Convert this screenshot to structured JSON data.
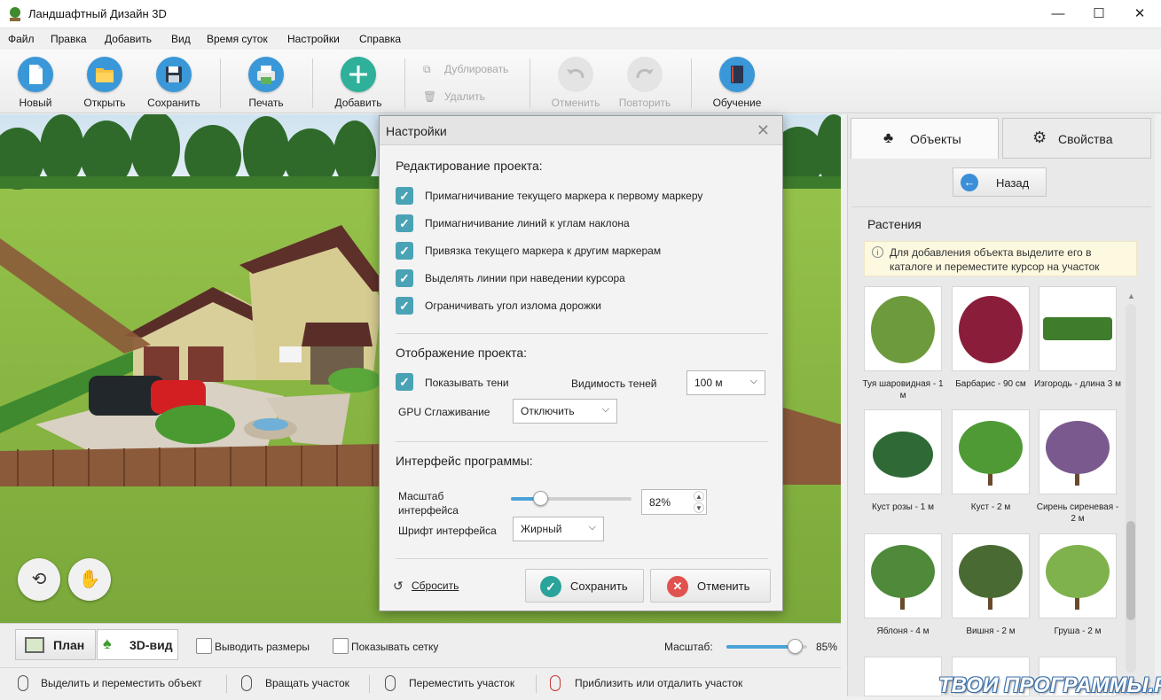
{
  "window": {
    "title": "Ландшафтный Дизайн 3D",
    "minimize": "—",
    "maximize": "☐",
    "close": "✕"
  },
  "menu": [
    "Файл",
    "Правка",
    "Добавить",
    "Вид",
    "Время суток",
    "Настройки",
    "Справка"
  ],
  "toolbar": {
    "new": "Новый",
    "open": "Открыть",
    "save": "Сохранить",
    "print": "Печать",
    "add": "Добавить",
    "duplicate": "Дублировать",
    "delete": "Удалить",
    "undo": "Отменить",
    "redo": "Повторить",
    "tutorial": "Обучение"
  },
  "dialog": {
    "title": "Настройки",
    "section_edit": "Редактирование проекта:",
    "edit_options": [
      {
        "label": "Примагничивание текущего маркера к первому маркеру",
        "checked": true
      },
      {
        "label": "Примагничивание линий к углам наклона",
        "checked": true
      },
      {
        "label": "Привязка текущего маркера к другим маркерам",
        "checked": true
      },
      {
        "label": "Выделять линии при наведении курсора",
        "checked": true
      },
      {
        "label": "Ограничивать угол излома дорожки",
        "checked": true
      }
    ],
    "section_display": "Отображение проекта:",
    "show_shadows": "Показывать тени",
    "shadow_visibility_label": "Видимость теней",
    "shadow_visibility_value": "100  м",
    "gpu_label": "GPU Сглаживание",
    "gpu_value": "Отключить",
    "section_interface": "Интерфейс программы:",
    "scale_label_1": "Масштаб",
    "scale_label_2": "интерфейса",
    "scale_value": "82%",
    "scale_fraction": 0.24,
    "font_label": "Шрифт интерфейса",
    "font_value": "Жирный",
    "reset": "Сбросить",
    "save": "Сохранить",
    "cancel": "Отменить",
    "colors": {
      "check": "#4aa3b5",
      "save_icon": "#2aa39a",
      "cancel_icon": "#e0524f"
    }
  },
  "panel": {
    "tab_objects": "Объекты",
    "tab_properties": "Свойства",
    "back": "Назад",
    "category": "Растения",
    "notice": "Для добавления объекта выделите его в каталоге и переместите курсор на участок",
    "items": [
      {
        "caption": "Туя шаровидная - 1 м",
        "color": "#6e9a3e"
      },
      {
        "caption": "Барбарис - 90 см",
        "color": "#8a1e3a"
      },
      {
        "caption": "Изгородь - длина 3 м",
        "color": "#3f7d2c"
      },
      {
        "caption": "Куст розы - 1 м",
        "color": "#2f6a36"
      },
      {
        "caption": "Куст - 2 м",
        "color": "#4f9a35"
      },
      {
        "caption": "Сирень сиреневая - 2 м",
        "color": "#7a5a8e"
      },
      {
        "caption": "Яблоня - 4 м",
        "color": "#4e8a3a"
      },
      {
        "caption": "Вишня - 2 м",
        "color": "#4a6a34"
      },
      {
        "caption": "Груша - 2 м",
        "color": "#7fb24c"
      }
    ]
  },
  "viewbar": {
    "plan": "План",
    "view3d": "3D-вид",
    "show_sizes": "Выводить размеры",
    "show_grid": "Показывать сетку",
    "zoom_label": "Масштаб:",
    "zoom_value": "85%",
    "zoom_fraction": 0.85
  },
  "statusbar": [
    "Выделить и переместить объект",
    "Вращать участок",
    "Переместить участок",
    "Приблизить или отдалить участок"
  ],
  "watermark": "ТВОИ ПРОГРАММЫ.РУ"
}
